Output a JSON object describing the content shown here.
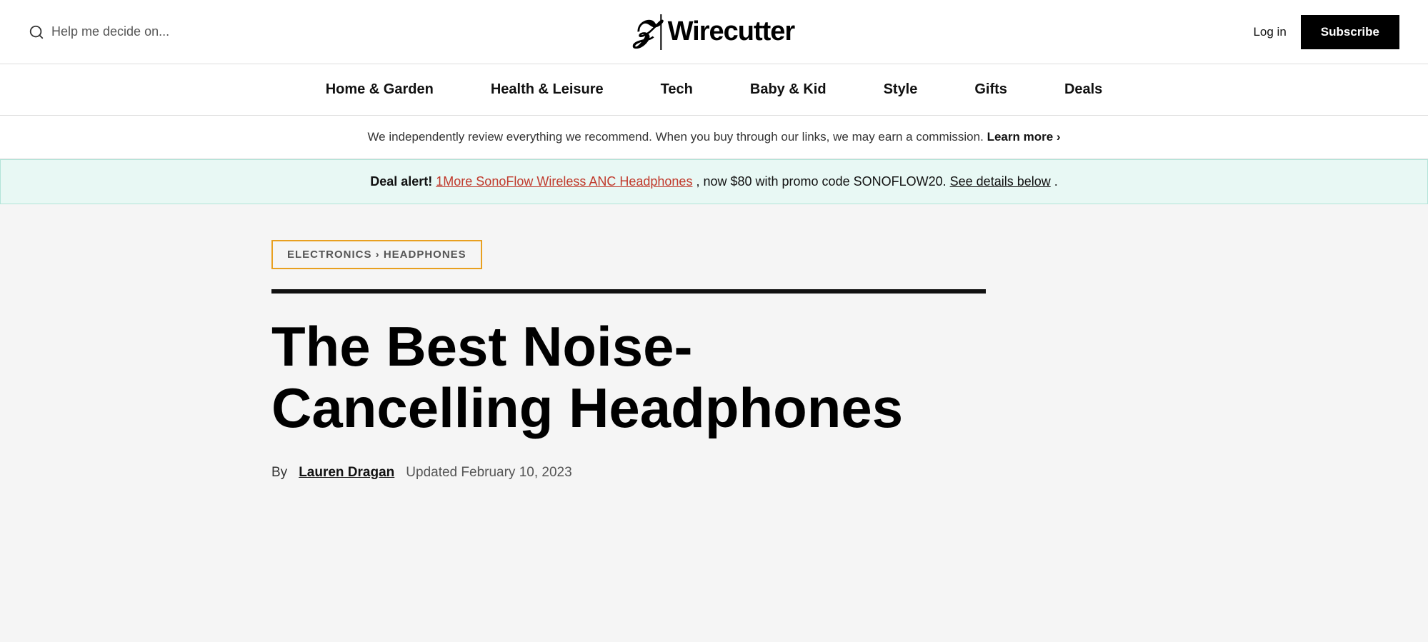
{
  "header": {
    "search_placeholder": "Help me decide on...",
    "logo_nyt": "𝒩",
    "logo_divider": "|",
    "logo_wirecutter": "Wirecutter",
    "login_label": "Log in",
    "subscribe_label": "Subscribe"
  },
  "nav": {
    "items": [
      {
        "label": "Home & Garden",
        "id": "home-garden"
      },
      {
        "label": "Health & Leisure",
        "id": "health-leisure"
      },
      {
        "label": "Tech",
        "id": "tech"
      },
      {
        "label": "Baby & Kid",
        "id": "baby-kid"
      },
      {
        "label": "Style",
        "id": "style"
      },
      {
        "label": "Gifts",
        "id": "gifts"
      },
      {
        "label": "Deals",
        "id": "deals"
      }
    ]
  },
  "disclaimer": {
    "text": "We independently review everything we recommend. When you buy through our links, we may earn a commission.",
    "link_text": "Learn more ›"
  },
  "deal_alert": {
    "label": "Deal alert!",
    "product_name": "1More SonoFlow Wireless ANC Headphones",
    "middle_text": ", now $80 with promo code SONOFLOW20.",
    "details_link": "See details below",
    "end_text": "."
  },
  "breadcrumb": {
    "text": "ELECTRONICS › HEADPHONES"
  },
  "article": {
    "title": "The Best Noise-Cancelling Headphones",
    "byline_prefix": "By",
    "author": "Lauren Dragan",
    "updated_text": "Updated February 10, 2023"
  },
  "colors": {
    "deal_alert_bg": "#e8f8f4",
    "deal_alert_border": "#b2e4d8",
    "breadcrumb_border": "#e8a020",
    "product_link_color": "#c0392b",
    "subscribe_bg": "#000000",
    "subscribe_text": "#ffffff"
  }
}
